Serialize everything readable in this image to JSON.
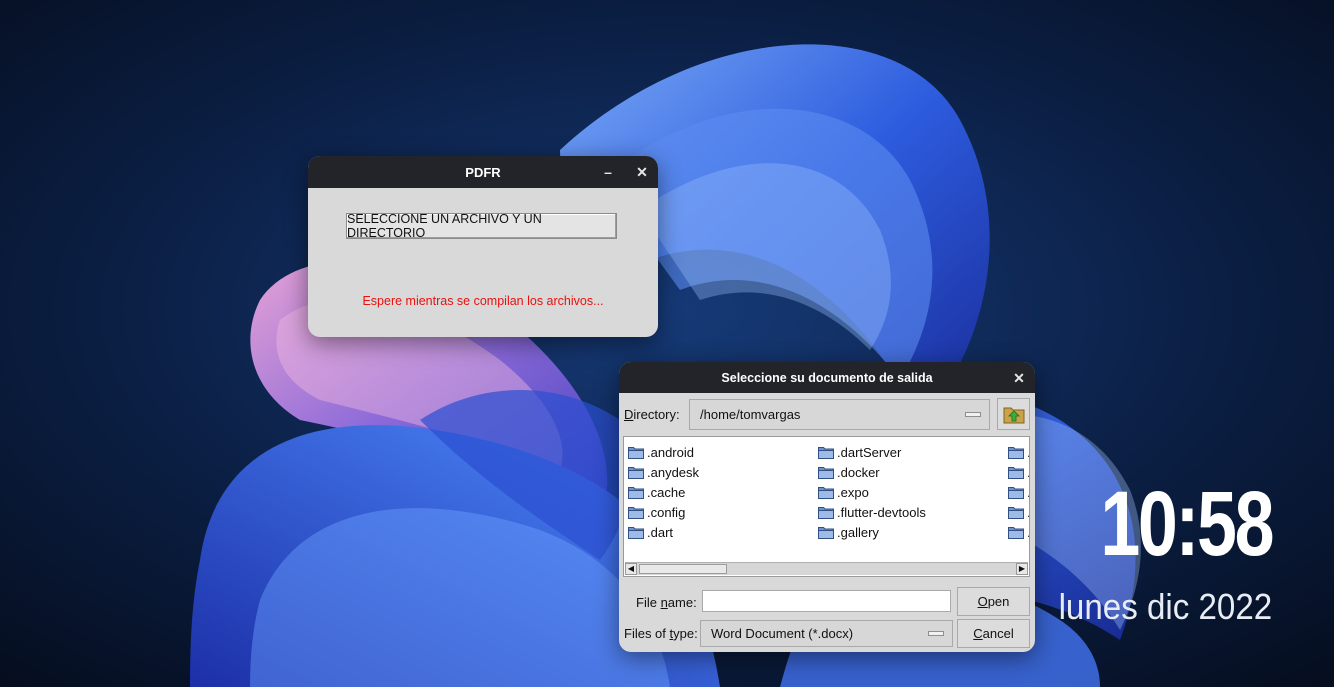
{
  "desktop": {
    "clock": {
      "time": "10:58",
      "date": "lunes dic 2022"
    }
  },
  "pdfr_window": {
    "title": "PDFR",
    "minimize_glyph": "–",
    "close_glyph": "✕",
    "select_button_label": "SELECCIONE UN ARCHIVO Y UN DIRECTORIO",
    "status_text": "Espere mientras se compilan los archivos...",
    "status_color": "#e8120f"
  },
  "file_dialog": {
    "title": "Seleccione su documento de salida",
    "close_glyph": "✕",
    "directory_label": {
      "before": "",
      "underlined": "D",
      "after": "irectory:"
    },
    "directory_value": "/home/tomvargas",
    "columns": [
      [
        ".android",
        ".anydesk",
        ".cache",
        ".config",
        ".dart"
      ],
      [
        ".dartServer",
        ".docker",
        ".expo",
        ".flutter-devtools",
        ".gallery"
      ],
      [
        ".",
        ".",
        ".",
        ".",
        "."
      ]
    ],
    "file_name_label": {
      "before": "File ",
      "underlined": "n",
      "after": "ame:"
    },
    "file_name_value": "",
    "files_of_type_label": {
      "before": "Files of ",
      "underlined": "t",
      "after": "ype:"
    },
    "files_of_type_value": "Word Document (*.docx)",
    "open_button": {
      "before": "",
      "underlined": "O",
      "after": "pen"
    },
    "cancel_button": {
      "before": "",
      "underlined": "C",
      "after": "ancel"
    }
  }
}
